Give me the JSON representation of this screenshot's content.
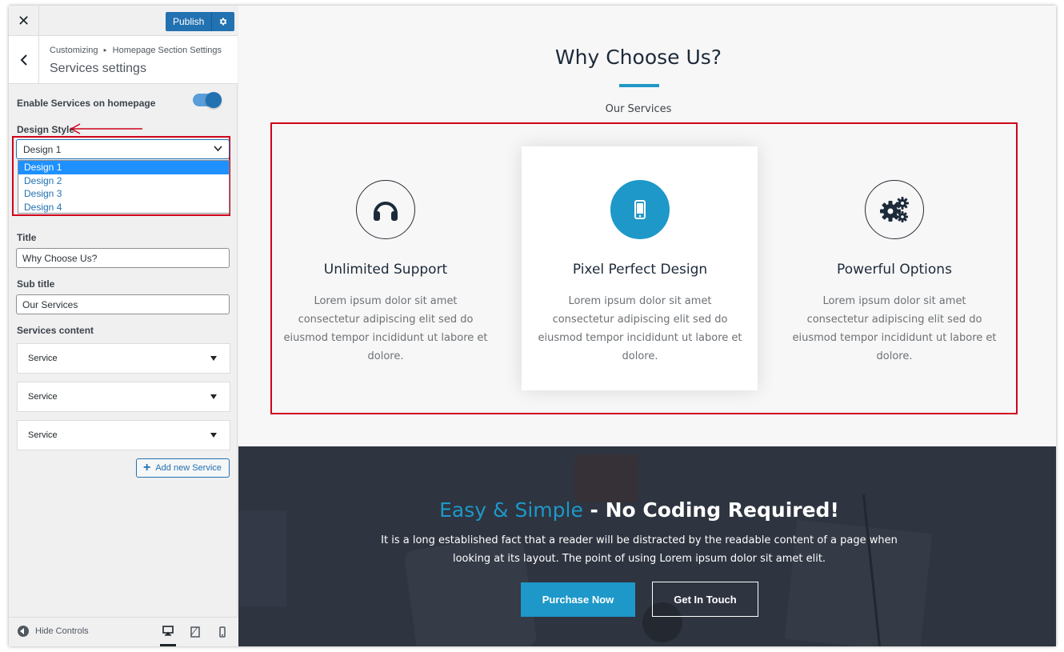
{
  "topbar": {
    "close_symbol": "✕",
    "publish_label": "Publish"
  },
  "section": {
    "breadcrumb_parent": "Customizing",
    "breadcrumb_sep": "▸",
    "breadcrumb_current": "Homepage Section Settings",
    "title": "Services settings"
  },
  "controls": {
    "enable_label": "Enable Services on homepage",
    "enable_value": true,
    "design_label": "Design Style",
    "design_selected": "Design 1",
    "design_options": [
      "Design 1",
      "Design 2",
      "Design 3",
      "Design 4"
    ],
    "title_label": "Title",
    "title_value": "Why Choose Us?",
    "subtitle_label": "Sub title",
    "subtitle_value": "Our Services",
    "content_label": "Services content",
    "service_items": [
      "Service",
      "Service",
      "Service"
    ],
    "add_label": "Add new Service"
  },
  "footer": {
    "hide_label": "Hide Controls",
    "devices": [
      "desktop-icon",
      "tablet-icon",
      "mobile-icon"
    ]
  },
  "preview": {
    "title": "Why Choose Us?",
    "subtitle": "Our Services",
    "services": [
      {
        "icon": "headphones-icon",
        "title": "Unlimited Support",
        "text": "Lorem ipsum dolor sit amet consectetur adipiscing elit sed do eiusmod tempor incididunt ut labore et dolore."
      },
      {
        "icon": "mobile-icon",
        "title": "Pixel Perfect Design",
        "text": "Lorem ipsum dolor sit amet consectetur adipiscing elit sed do eiusmod tempor incididunt ut labore et dolore."
      },
      {
        "icon": "gears-icon",
        "title": "Powerful Options",
        "text": "Lorem ipsum dolor sit amet consectetur adipiscing elit sed do eiusmod tempor incididunt ut labore et dolore."
      }
    ],
    "cta": {
      "title_accent": "Easy & Simple",
      "title_rest": " - No Coding Required!",
      "text": "It is a long established fact that a reader will be distracted by the readable content of a page when looking at its layout. The point of using Lorem ipsum dolor sit amet elit.",
      "primary_button": "Purchase Now",
      "secondary_button": "Get In Touch"
    }
  },
  "colors": {
    "accent": "#1e98c8",
    "wp_blue": "#2271b1",
    "highlight_red": "#d0021b",
    "cta_bg": "#2e3440"
  }
}
